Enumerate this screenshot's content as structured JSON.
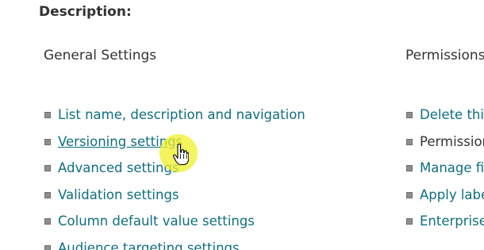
{
  "description": {
    "label": "Description:"
  },
  "general_settings": {
    "heading": "General Settings",
    "items": [
      {
        "label": "List name, description and navigation"
      },
      {
        "label": "Versioning settings"
      },
      {
        "label": "Advanced settings"
      },
      {
        "label": "Validation settings"
      },
      {
        "label": "Column default value settings"
      },
      {
        "label": "Audience targeting settings"
      }
    ]
  },
  "permissions": {
    "heading": "Permissions",
    "items": [
      {
        "label": "Delete this"
      },
      {
        "label": "Permission"
      },
      {
        "label": "Manage fil"
      },
      {
        "label": "Apply labe"
      },
      {
        "label": "Enterprise"
      }
    ]
  },
  "colors": {
    "link": "#0f6f7f",
    "text": "#333333",
    "cursor_highlight": "#f0f028"
  }
}
